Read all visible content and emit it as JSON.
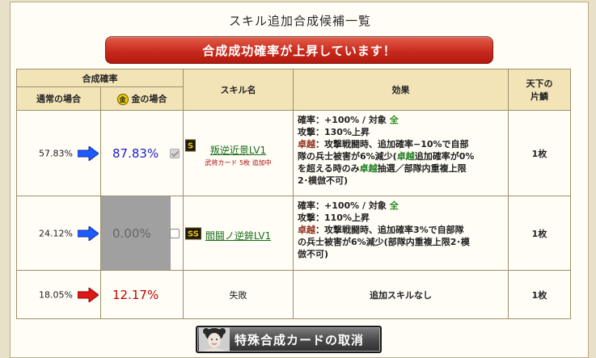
{
  "title": "スキル追加合成候補一覧",
  "banner": "合成成功確率が上昇しています！",
  "headers": {
    "rate_group": "合成確率",
    "normal": "通常の場合",
    "gold": "金の場合",
    "gold_badge": "金",
    "skill": "スキル名",
    "effect": "効果",
    "cost_l1": "天下の",
    "cost_l2": "片鱗"
  },
  "rows": [
    {
      "normal": "57.83%",
      "gold": "87.83%",
      "rank": "S",
      "skill": "叛逆近景LV1",
      "note": "武将カード 5枚 追加中",
      "effect": {
        "l1a": "確率：+100%  /  対象 ",
        "l1b": "全",
        "l2": "攻撃：130%上昇",
        "l3a": "卓越",
        "l3b": "：攻撃戦闘時、追加確率−10%で自部",
        "l4": "隊の兵士被害が6%減少(",
        "l4b": "卓越",
        "l4c": "追加確率が0%",
        "l5a": "を超える時のみ",
        "l5b": "卓越",
        "l5c": "抽選／部隊内重複上限",
        "l6": "2･模倣不可)"
      },
      "cost": "1枚"
    },
    {
      "normal": "24.12%",
      "gold": "0.00%",
      "rank": "SS",
      "skill": "閻鬪ノ逆鉾LV1",
      "effect": {
        "l1a": "確率：+100%  /  対象 ",
        "l1b": "全",
        "l2": "攻撃：110%上昇",
        "l3a": "卓越",
        "l3b": "：攻撃戦闘時、追加確率3%で自部隊",
        "l4": "の兵士被害が6%減少(部隊内重複上限2･模",
        "l5": "倣不可)"
      },
      "cost": "1枚"
    },
    {
      "normal": "18.05%",
      "gold": "12.17%",
      "skill": "失敗",
      "effect": "追加スキルなし",
      "cost": "1枚"
    }
  ],
  "cancel_button": "特殊合成カードの取消",
  "colors": {
    "banner": "#c82b1d",
    "header_bg": "#f3e4b8",
    "arrow_blue": "#1e5bff",
    "arrow_red": "#e01515"
  }
}
